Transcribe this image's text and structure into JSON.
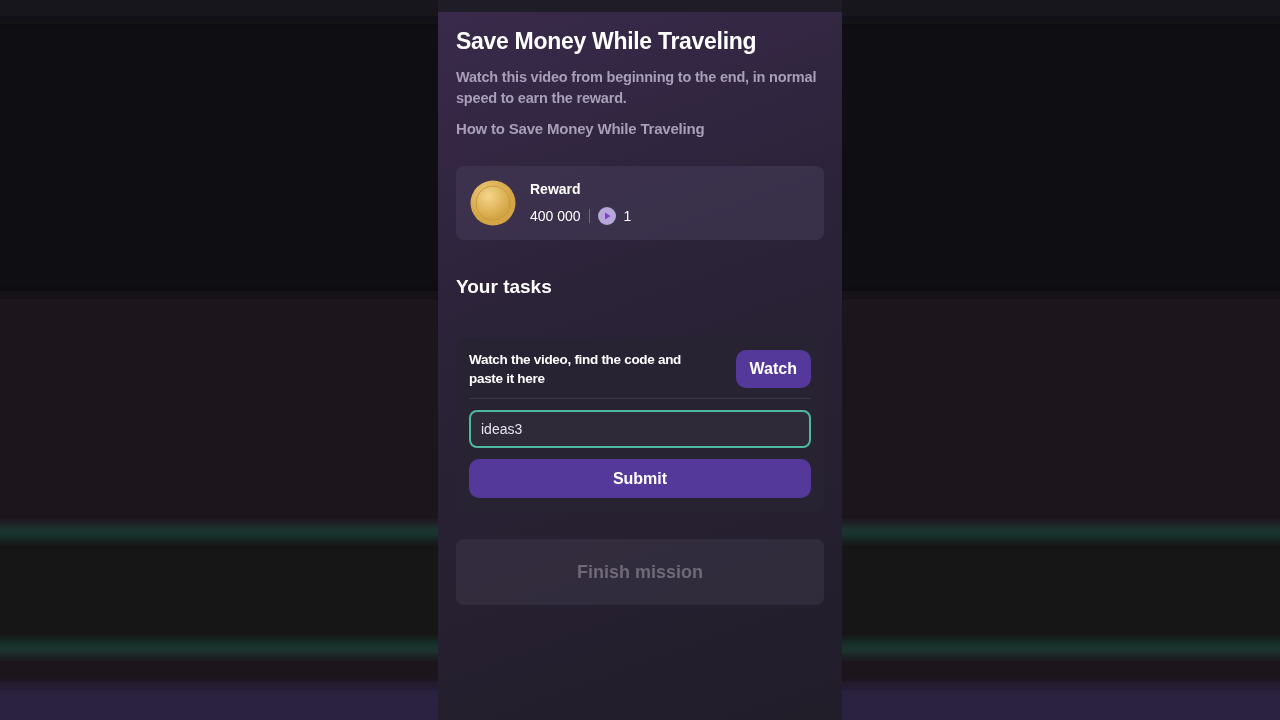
{
  "mission": {
    "title": "Save Money While Traveling",
    "description": "Watch this video from beginning to the end, in normal speed to earn the reward.",
    "video_title": "How to Save Money While Traveling"
  },
  "reward": {
    "label": "Reward",
    "amount": "400 000",
    "count": "1"
  },
  "tasks": {
    "heading": "Your tasks",
    "items": [
      {
        "instruction": "Watch the video, find the code and paste it here",
        "watch_button": "Watch",
        "code_value": "ideas3",
        "focused": true,
        "submit_button": "Submit"
      }
    ]
  },
  "finish_button": {
    "label": "Finish mission",
    "disabled": true
  }
}
